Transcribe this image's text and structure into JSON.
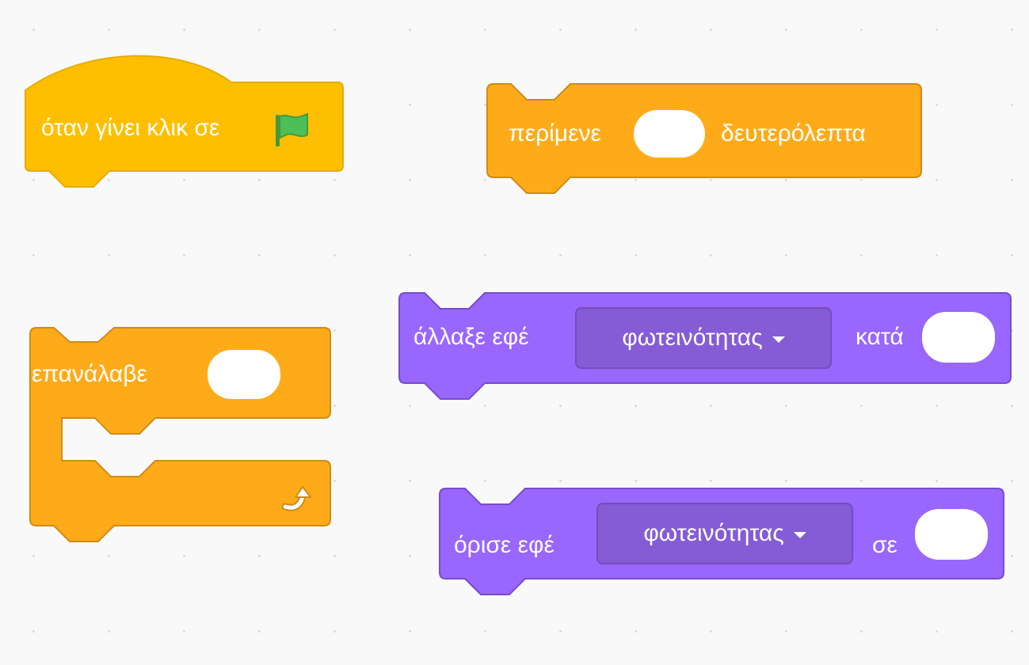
{
  "colors": {
    "events": "#ffbf00",
    "events_border": "#e6ac00",
    "control": "#ffab19",
    "control_border": "#cf8b17",
    "looks": "#9966ff",
    "looks_border": "#774dcb",
    "looks_dropdown": "#855cd6",
    "flag": "#4cbf56"
  },
  "blocks": {
    "when_flag_clicked": {
      "label": "όταν γίνει κλικ σε",
      "icon": "green-flag-icon"
    },
    "wait": {
      "label_before": "περίμενε",
      "label_after": "δευτερόλεπτα"
    },
    "repeat": {
      "label": "επανάλαβε",
      "loop_icon": "loop-arrow-icon"
    },
    "change_effect": {
      "label_before": "άλλαξε εφέ",
      "dropdown_value": "φωτεινότητας",
      "label_after": "κατά"
    },
    "set_effect": {
      "label_before": "όρισε εφέ",
      "dropdown_value": "φωτεινότητας",
      "label_after": "σε"
    }
  }
}
